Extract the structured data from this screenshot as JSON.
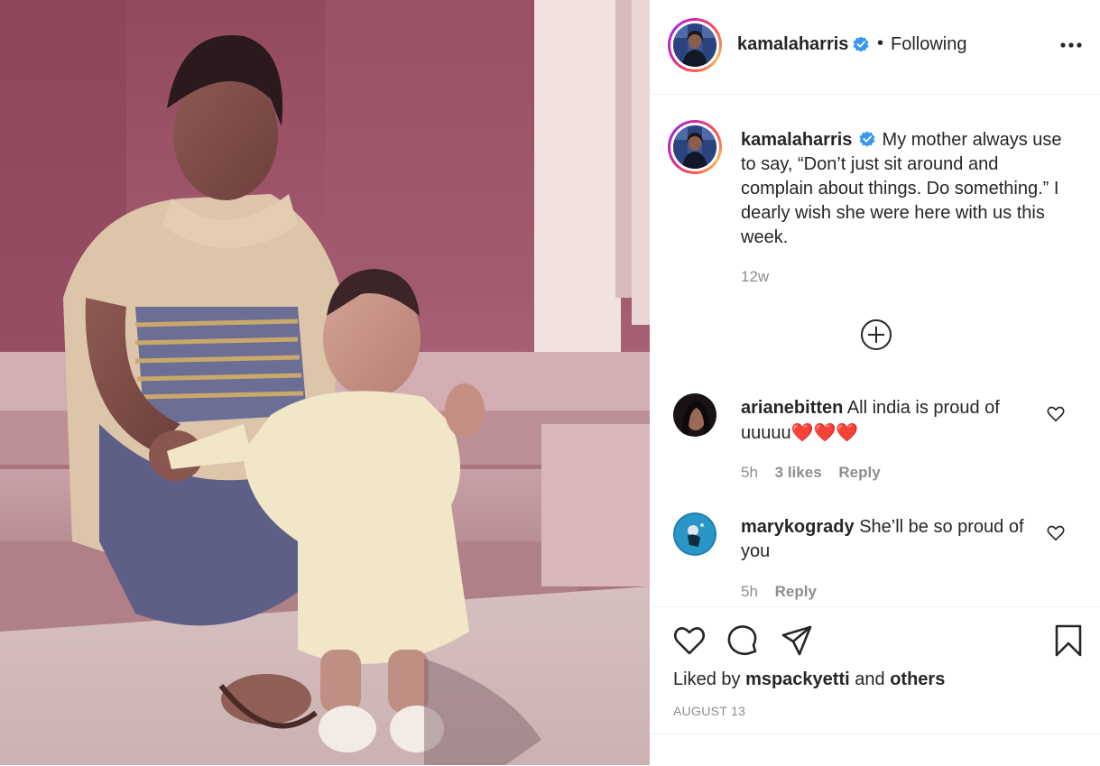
{
  "post": {
    "username": "kamalaharris",
    "follow_separator": "•",
    "follow_status": "Following",
    "caption": "My mother always use to say, “Don’t just sit around and complain about things. Do something.” I dearly wish she were here with us this week.",
    "caption_age": "12w",
    "liked_prefix": "Liked by",
    "liked_user": "mspackyetti",
    "liked_and": "and",
    "liked_others": "others",
    "date": "AUGUST 13"
  },
  "comments": [
    {
      "username": "arianebitten",
      "text": "All india is proud of uuuuu",
      "emoji": "❤️❤️❤️",
      "age": "5h",
      "likes": "3 likes",
      "reply": "Reply"
    },
    {
      "username": "marykogrady",
      "text": "She’ll be so proud of you",
      "age": "5h",
      "reply": "Reply"
    }
  ],
  "icons": {
    "verified": "verified-badge-icon",
    "more": "more-options-icon",
    "load_more": "plus-circle-icon",
    "like": "heart-icon",
    "comment": "comment-bubble-icon",
    "share": "paper-plane-icon",
    "save": "bookmark-icon"
  },
  "colors": {
    "verified_blue": "#3897f0",
    "text": "#262626",
    "muted": "#8e8e8e",
    "divider": "#efefef"
  }
}
